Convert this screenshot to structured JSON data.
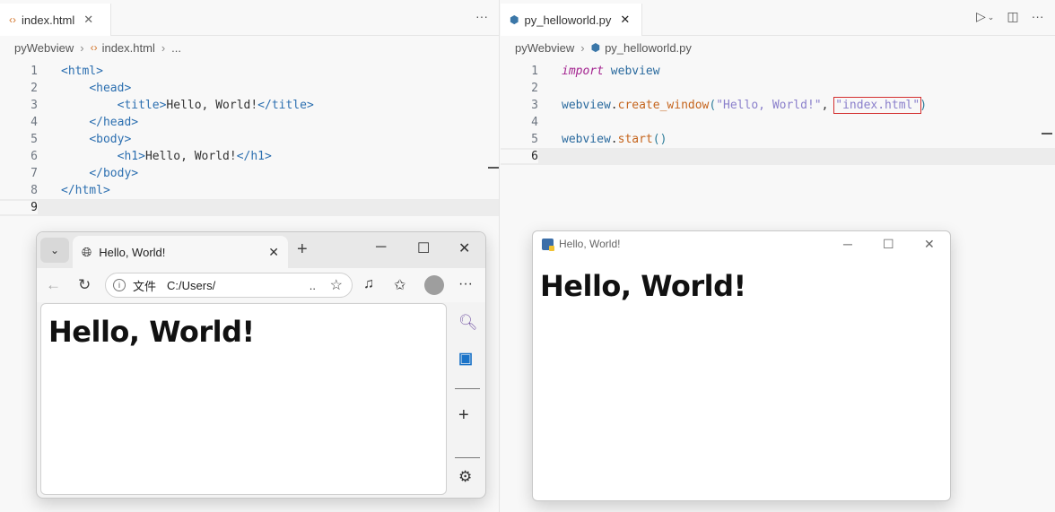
{
  "left_editor": {
    "tab_label": "index.html",
    "tab_close": "✕",
    "more_actions": "···",
    "breadcrumb": {
      "folder": "pyWebview",
      "file": "index.html",
      "more": "..."
    },
    "lines": [
      {
        "num": "1",
        "indent": "",
        "open": "<html>",
        "text": "",
        "close": ""
      },
      {
        "num": "2",
        "indent": "    ",
        "open": "<head>",
        "text": "",
        "close": ""
      },
      {
        "num": "3",
        "indent": "        ",
        "open": "<title>",
        "text": "Hello, World!",
        "close": "</title>"
      },
      {
        "num": "4",
        "indent": "    ",
        "open": "</head>",
        "text": "",
        "close": ""
      },
      {
        "num": "5",
        "indent": "    ",
        "open": "<body>",
        "text": "",
        "close": ""
      },
      {
        "num": "6",
        "indent": "        ",
        "open": "<h1>",
        "text": "Hello, World!",
        "close": "</h1>"
      },
      {
        "num": "7",
        "indent": "    ",
        "open": "</body>",
        "text": "",
        "close": ""
      },
      {
        "num": "8",
        "indent": "",
        "open": "</html>",
        "text": "",
        "close": ""
      },
      {
        "num": "9",
        "indent": "",
        "open": "",
        "text": "",
        "close": ""
      }
    ]
  },
  "right_editor": {
    "tab_label": "py_helloworld.py",
    "tab_close": "✕",
    "breadcrumb": {
      "folder": "pyWebview",
      "file": "py_helloworld.py"
    },
    "line_numbers": [
      "1",
      "2",
      "3",
      "4",
      "5",
      "6"
    ],
    "code": {
      "l1_kw": "import",
      "l1_mod": "webview",
      "l3_obj": "webview",
      "l3_dot": ".",
      "l3_fn": "create_window",
      "l3_open": "(",
      "l3_arg1": "\"Hello, World!\"",
      "l3_comma": ", ",
      "l3_arg2": "\"index.html\"",
      "l3_close": ")",
      "l5_obj": "webview",
      "l5_dot": ".",
      "l5_fn": "start",
      "l5_parens": "()"
    }
  },
  "browser": {
    "tab_title": "Hello, World!",
    "address_label": "文件",
    "address_value": "C:/Users/",
    "address_ellipsis": "..",
    "more_menu": "···",
    "heading": "Hello, World!"
  },
  "pywebview_window": {
    "title": "Hello, World!",
    "heading": "Hello, World!"
  },
  "colors": {
    "highlight_box": "#d32f2f",
    "string": "#8a7fcb",
    "keyword": "#a3238f",
    "function": "#c5641c"
  }
}
